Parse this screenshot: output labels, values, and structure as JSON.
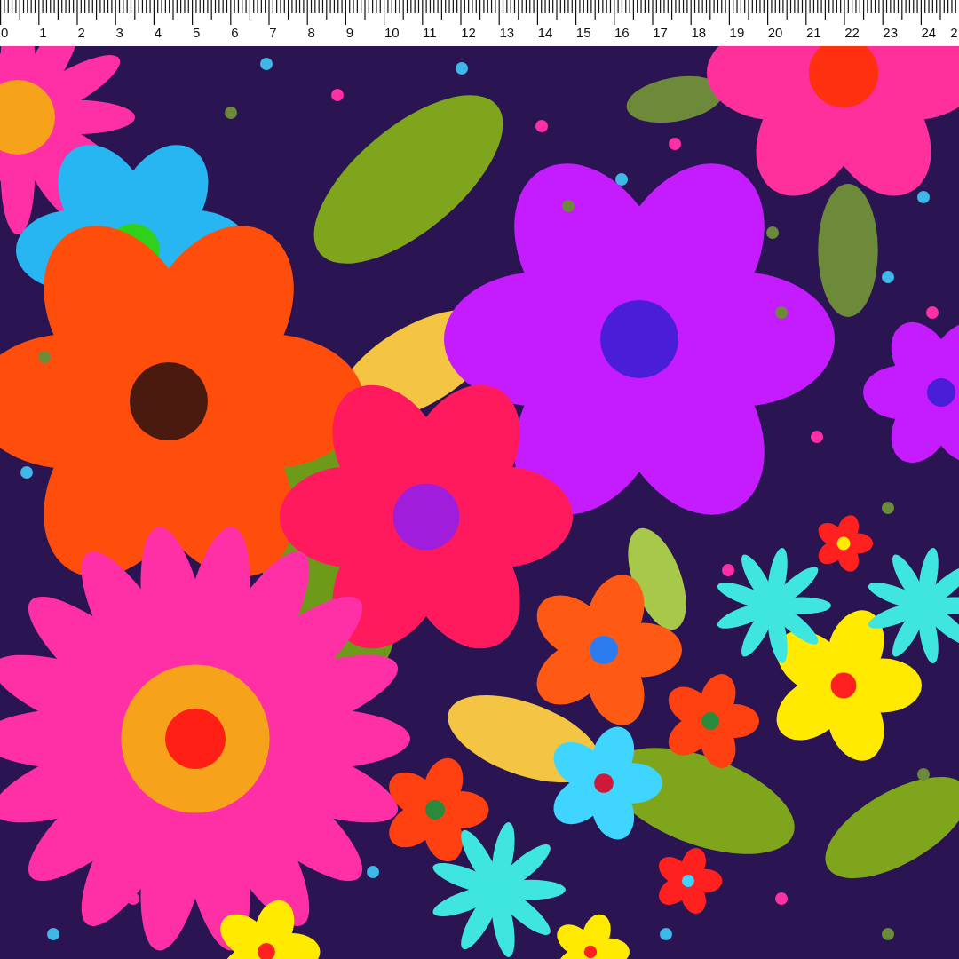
{
  "ruler": {
    "labels": [
      "0",
      "1",
      "2",
      "3",
      "4",
      "5",
      "6",
      "7",
      "8",
      "9",
      "10",
      "11",
      "12",
      "13",
      "14",
      "15",
      "16",
      "17",
      "18",
      "19",
      "20",
      "21",
      "22",
      "23",
      "24",
      "2"
    ]
  }
}
